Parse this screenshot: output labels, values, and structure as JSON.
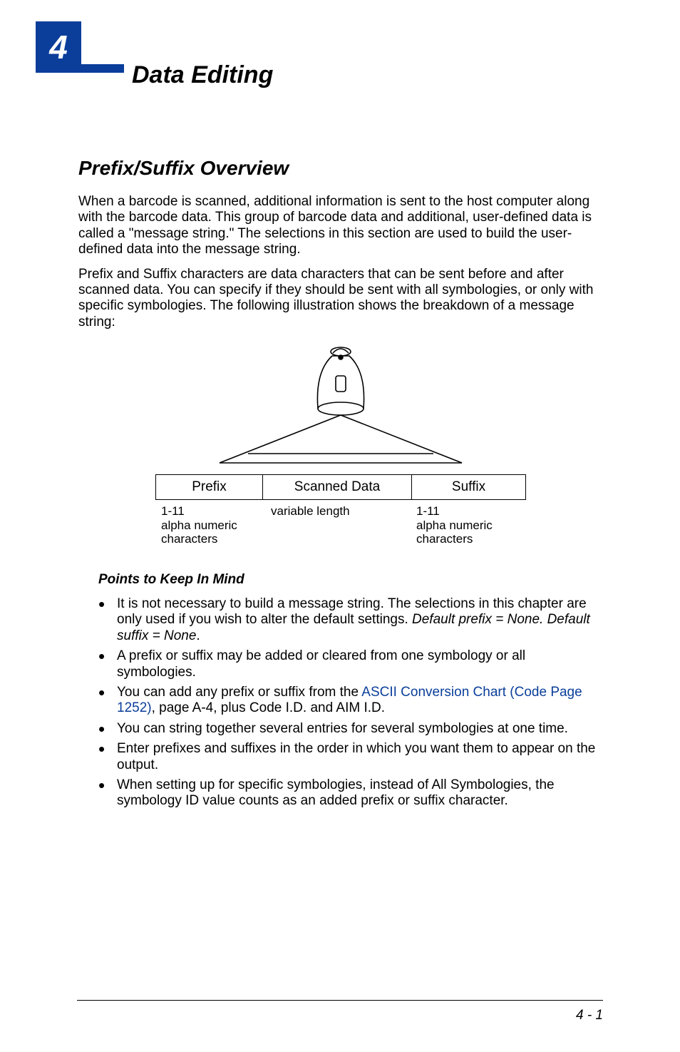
{
  "chapter": {
    "number": "4",
    "title": "Data Editing"
  },
  "section": {
    "heading": "Prefix/Suffix Overview",
    "para1": "When a barcode is scanned, additional information is sent to the host computer along with the barcode data.  This group of barcode data and additional, user-defined data is called a \"message string.\"  The selections in this section are used to build the user-defined data into the message string.",
    "para2": "Prefix and Suffix characters are data characters that can be sent before and after scanned data.  You can specify if they should be sent with all symbologies, or only with specific symbologies.  The following illustration shows the breakdown of a message string:"
  },
  "diagram": {
    "cells": {
      "prefix": "Prefix",
      "scanned": "Scanned Data",
      "suffix": "Suffix"
    },
    "notes": {
      "prefix_range": "1-11",
      "prefix_desc": "alpha numeric characters",
      "scanned_desc": "variable length",
      "suffix_range": "1-11",
      "suffix_desc": "alpha numeric characters"
    }
  },
  "points": {
    "heading": "Points to Keep In Mind",
    "item1_a": "It is not necessary to build a message string.  The selections in this chapter are only used if you wish to alter the default settings.  ",
    "item1_b": "Default prefix = None.  Default suffix = None",
    "item1_c": ".",
    "item2": "A prefix or suffix may be added or cleared from one symbology or all symbologies.",
    "item3_a": "You can add any prefix or suffix from the ",
    "item3_link": "ASCII Conversion Chart (Code Page 1252)",
    "item3_b": ", page A-4, plus Code I.D. and AIM I.D.",
    "item4": "You can string together several entries for several symbologies at one time.",
    "item5": "Enter prefixes and suffixes in the order in which you want them to appear on the output.",
    "item6": "When setting up for specific symbologies, instead of All Symbologies, the symbology ID value counts as an added prefix or suffix character."
  },
  "footer": {
    "page_number": "4 - 1"
  }
}
